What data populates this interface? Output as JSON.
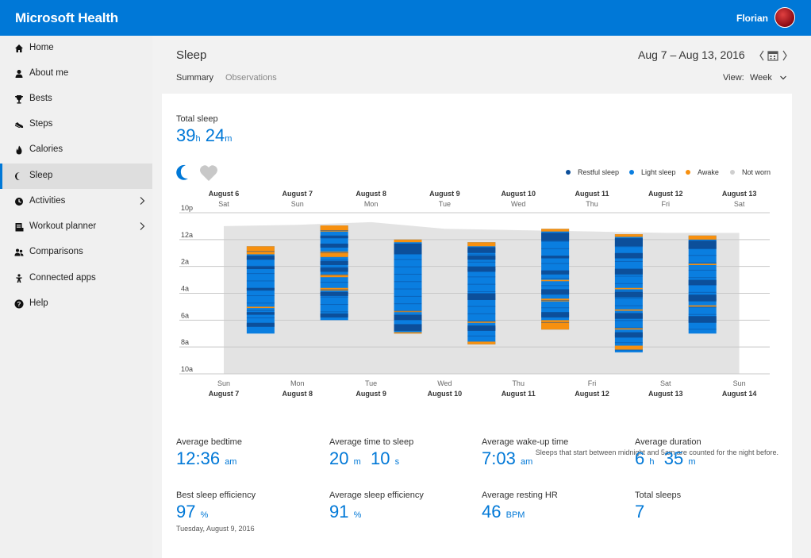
{
  "app": {
    "title": "Microsoft Health",
    "user_name": "Florian"
  },
  "sidebar": {
    "items": [
      {
        "label": "Home",
        "icon": "home-icon"
      },
      {
        "label": "About me",
        "icon": "person-icon"
      },
      {
        "label": "Bests",
        "icon": "trophy-icon"
      },
      {
        "label": "Steps",
        "icon": "shoe-icon"
      },
      {
        "label": "Calories",
        "icon": "flame-icon"
      },
      {
        "label": "Sleep",
        "icon": "moon-icon",
        "active": true
      },
      {
        "label": "Activities",
        "icon": "activity-icon",
        "submenu": true
      },
      {
        "label": "Workout planner",
        "icon": "workout-icon",
        "submenu": true
      },
      {
        "label": "Comparisons",
        "icon": "comparisons-icon"
      },
      {
        "label": "Connected apps",
        "icon": "connected-apps-icon"
      },
      {
        "label": "Help",
        "icon": "help-icon"
      }
    ]
  },
  "header": {
    "title": "Sleep",
    "date_range": "Aug 7 – Aug 13, 2016",
    "tabs": [
      {
        "label": "Summary",
        "active": true
      },
      {
        "label": "Observations",
        "active": false
      }
    ],
    "view_label": "View:",
    "view_value": "Week"
  },
  "total_sleep": {
    "label": "Total sleep",
    "hours": "39",
    "hours_unit": "h",
    "minutes": "24",
    "minutes_unit": "m"
  },
  "chart_data": {
    "type": "bar",
    "colors": {
      "restful": "#0c4f9a",
      "light": "#0a7ee0",
      "awake": "#f7900f",
      "not_worn": "#e3e3e3",
      "grid": "#c8c8c8"
    },
    "legend": [
      {
        "label": "Restful sleep",
        "color": "#0c4f9a"
      },
      {
        "label": "Light sleep",
        "color": "#0a7ee0"
      },
      {
        "label": "Awake",
        "color": "#f7900f"
      },
      {
        "label": "Not worn",
        "color": "#cfcfcf"
      }
    ],
    "top_dates": [
      {
        "date": "August 6",
        "day": "Sat"
      },
      {
        "date": "August 7",
        "day": "Sun"
      },
      {
        "date": "August 8",
        "day": "Mon"
      },
      {
        "date": "August 9",
        "day": "Tue"
      },
      {
        "date": "August 10",
        "day": "Wed"
      },
      {
        "date": "August 11",
        "day": "Thu"
      },
      {
        "date": "August 12",
        "day": "Fri"
      },
      {
        "date": "August 13",
        "day": "Sat"
      }
    ],
    "bottom_dates": [
      {
        "day": "Sun",
        "date": "August 7"
      },
      {
        "day": "Mon",
        "date": "August 8"
      },
      {
        "day": "Tue",
        "date": "August 9"
      },
      {
        "day": "Wed",
        "date": "August 10"
      },
      {
        "day": "Thu",
        "date": "August 11"
      },
      {
        "day": "Fri",
        "date": "August 12"
      },
      {
        "day": "Sat",
        "date": "August 13"
      },
      {
        "day": "Sun",
        "date": "August 14"
      }
    ],
    "y_ticks": [
      "10p",
      "12a",
      "2a",
      "4a",
      "6a",
      "8a",
      "10a"
    ],
    "y_range_hours": [
      22,
      34
    ],
    "not_worn_top_hours": [
      23.0,
      22.9,
      22.7,
      23.2,
      23.3,
      23.4,
      23.5,
      23.5
    ],
    "sleeps": [
      {
        "night": "Aug 7",
        "start": 24.5,
        "end": 31.0,
        "awake": [
          [
            24.5,
            25.1
          ],
          [
            29.0,
            29.1
          ]
        ],
        "restful": [
          [
            25.2,
            25.5
          ],
          [
            26.0,
            26.2
          ],
          [
            27.6,
            27.8
          ],
          [
            29.4,
            29.6
          ],
          [
            30.2,
            30.5
          ]
        ]
      },
      {
        "night": "Aug 8",
        "start": 22.95,
        "end": 30.0,
        "awake": [
          [
            22.95,
            23.4
          ],
          [
            24.9,
            25.3
          ],
          [
            26.6,
            26.8
          ],
          [
            27.6,
            27.8
          ]
        ],
        "restful": [
          [
            23.7,
            23.9
          ],
          [
            24.3,
            24.6
          ],
          [
            25.6,
            25.9
          ],
          [
            26.1,
            26.4
          ],
          [
            27.9,
            28.2
          ],
          [
            29.5,
            29.8
          ]
        ]
      },
      {
        "night": "Aug 9",
        "start": 24.0,
        "end": 31.0,
        "awake": [
          [
            24.0,
            24.2
          ],
          [
            29.3,
            29.4
          ],
          [
            30.9,
            31.0
          ]
        ],
        "restful": [
          [
            24.3,
            25.1
          ],
          [
            29.6,
            30.0
          ],
          [
            30.3,
            30.8
          ]
        ]
      },
      {
        "night": "Aug 10",
        "start": 24.2,
        "end": 31.8,
        "awake": [
          [
            24.2,
            24.5
          ],
          [
            30.1,
            30.2
          ],
          [
            31.6,
            31.8
          ]
        ],
        "restful": [
          [
            24.6,
            25.0
          ],
          [
            25.2,
            25.5
          ],
          [
            26.0,
            26.4
          ],
          [
            28.0,
            28.5
          ],
          [
            30.4,
            30.8
          ]
        ]
      },
      {
        "night": "Aug 11",
        "start": 23.2,
        "end": 30.7,
        "awake": [
          [
            23.2,
            23.4
          ],
          [
            27.0,
            27.1
          ],
          [
            28.4,
            28.6
          ],
          [
            30.0,
            30.7
          ]
        ],
        "restful": [
          [
            23.5,
            24.1
          ],
          [
            25.2,
            25.4
          ],
          [
            26.3,
            26.6
          ],
          [
            27.7,
            28.1
          ],
          [
            29.4,
            29.8
          ]
        ]
      },
      {
        "night": "Aug 12",
        "start": 23.6,
        "end": 32.4,
        "awake": [
          [
            23.6,
            23.8
          ],
          [
            27.6,
            27.7
          ],
          [
            29.2,
            29.3
          ],
          [
            30.6,
            30.7
          ],
          [
            31.9,
            32.2
          ]
        ],
        "restful": [
          [
            23.9,
            24.5
          ],
          [
            25.0,
            25.4
          ],
          [
            26.2,
            26.6
          ],
          [
            27.9,
            28.3
          ],
          [
            29.5,
            29.9
          ],
          [
            30.9,
            31.3
          ]
        ]
      },
      {
        "night": "Aug 13",
        "start": 23.7,
        "end": 31.0,
        "awake": [
          [
            23.7,
            24.0
          ],
          [
            25.8,
            25.9
          ],
          [
            28.9,
            29.0
          ]
        ],
        "restful": [
          [
            24.1,
            24.7
          ],
          [
            27.0,
            27.4
          ],
          [
            28.1,
            28.6
          ],
          [
            29.7,
            30.2
          ]
        ]
      }
    ],
    "note": "Sleeps that start between midnight and 5am are counted for the night before."
  },
  "stats": [
    {
      "label": "Average bedtime",
      "parts": [
        {
          "v": "12:36",
          "u": "am"
        }
      ]
    },
    {
      "label": "Average time to sleep",
      "parts": [
        {
          "v": "20",
          "u": "m"
        },
        {
          "v": "10",
          "u": "s"
        }
      ]
    },
    {
      "label": "Average wake-up time",
      "parts": [
        {
          "v": "7:03",
          "u": "am"
        }
      ]
    },
    {
      "label": "Average duration",
      "parts": [
        {
          "v": "6",
          "u": "h"
        },
        {
          "v": "35",
          "u": "m"
        }
      ]
    },
    {
      "label": "Best sleep efficiency",
      "parts": [
        {
          "v": "97",
          "u": "%"
        }
      ],
      "sub": "Tuesday, August 9, 2016"
    },
    {
      "label": "Average sleep efficiency",
      "parts": [
        {
          "v": "91",
          "u": "%"
        }
      ]
    },
    {
      "label": "Average resting HR",
      "parts": [
        {
          "v": "46",
          "u": "BPM"
        }
      ]
    },
    {
      "label": "Total sleeps",
      "parts": [
        {
          "v": "7",
          "u": ""
        }
      ]
    }
  ]
}
